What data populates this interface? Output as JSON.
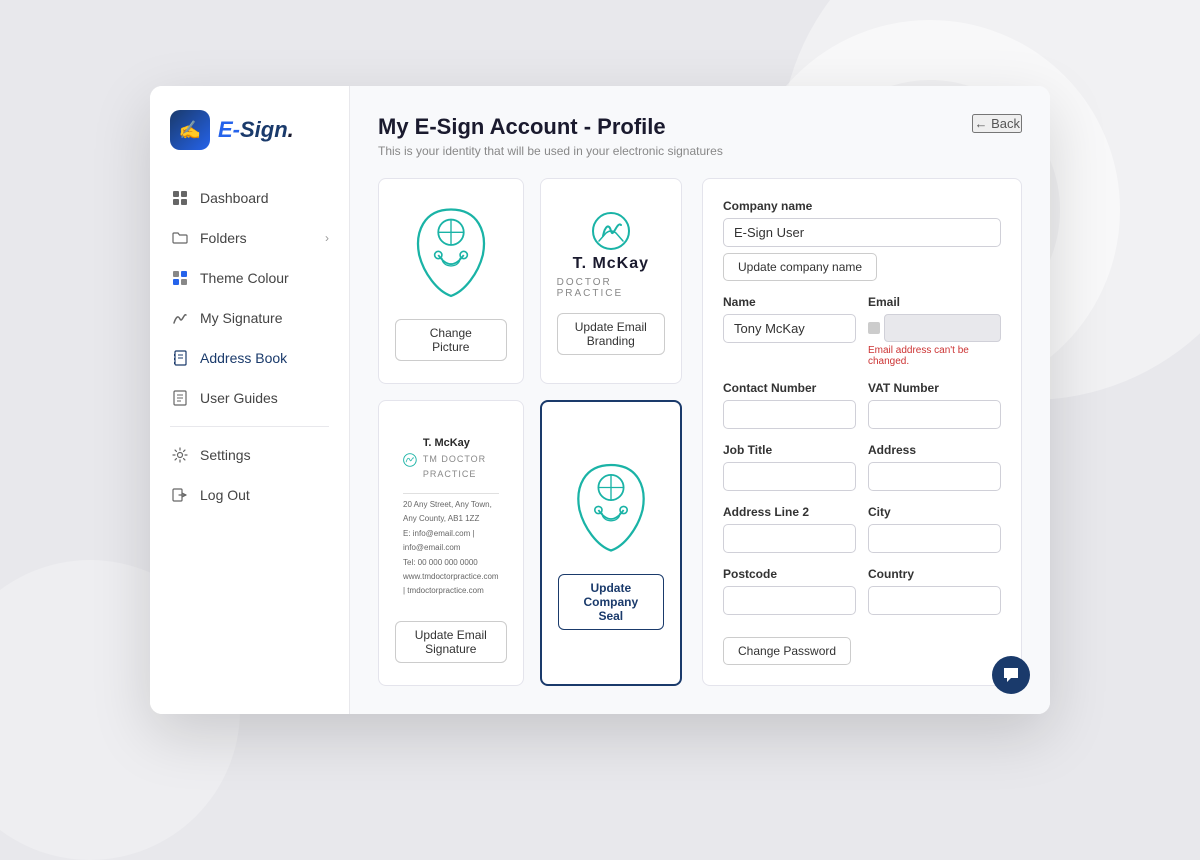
{
  "logo": {
    "icon_symbol": "✍",
    "text_part1": "E-",
    "text_part2": "Sign"
  },
  "sidebar": {
    "items": [
      {
        "id": "dashboard",
        "label": "Dashboard",
        "icon": "⊞",
        "has_arrow": false
      },
      {
        "id": "folders",
        "label": "Folders",
        "icon": "🗂",
        "has_arrow": true
      },
      {
        "id": "theme-colour",
        "label": "Theme Colour",
        "icon": "⊡",
        "has_arrow": false
      },
      {
        "id": "my-signature",
        "label": "My Signature",
        "icon": "✏",
        "has_arrow": false
      },
      {
        "id": "address-book",
        "label": "Address Book",
        "icon": "📒",
        "has_arrow": false
      },
      {
        "id": "user-guides",
        "label": "User Guides",
        "icon": "📖",
        "has_arrow": false
      },
      {
        "id": "settings",
        "label": "Settings",
        "icon": "⚙",
        "has_arrow": false
      },
      {
        "id": "log-out",
        "label": "Log Out",
        "icon": "🚪",
        "has_arrow": false
      }
    ]
  },
  "header": {
    "title": "My E-Sign Account - Profile",
    "subtitle": "This is your identity that will be used in your electronic signatures",
    "back_label": "← Back"
  },
  "panels": {
    "change_picture_btn": "Change Picture",
    "update_email_branding_btn": "Update Email Branding",
    "update_email_signature_btn": "Update Email Signature",
    "update_company_seal_btn": "Update Company Seal",
    "email_brand_name": "T. McKay",
    "email_brand_subtitle": "DOCTOR PRACTICE",
    "sig_name": "T. McKay",
    "sig_title": "TM DOCTOR PRACTICE",
    "sig_line1": "20 Any Street, Any Town, Any County, AB1 1ZZ",
    "sig_line2": "E: info@email.com | info@email.com",
    "sig_line3": "Tel: 00 000 000 0000",
    "sig_line4": "www.tmdoctorpractice.com | tmdoctorpractice.com"
  },
  "form": {
    "company_name_label": "Company name",
    "company_name_value": "E-Sign User",
    "update_company_name_btn": "Update company name",
    "name_label": "Name",
    "name_value": "Tony McKay",
    "email_label": "Email",
    "email_error": "Email address can't be changed.",
    "contact_number_label": "Contact Number",
    "contact_number_value": "",
    "vat_number_label": "VAT Number",
    "vat_number_value": "",
    "job_title_label": "Job Title",
    "job_title_value": "",
    "address_label": "Address",
    "address_value": "",
    "address_line2_label": "Address Line 2",
    "address_line2_value": "",
    "city_label": "City",
    "city_value": "",
    "postcode_label": "Postcode",
    "postcode_value": "",
    "country_label": "Country",
    "country_value": "",
    "change_password_btn": "Change Password"
  }
}
